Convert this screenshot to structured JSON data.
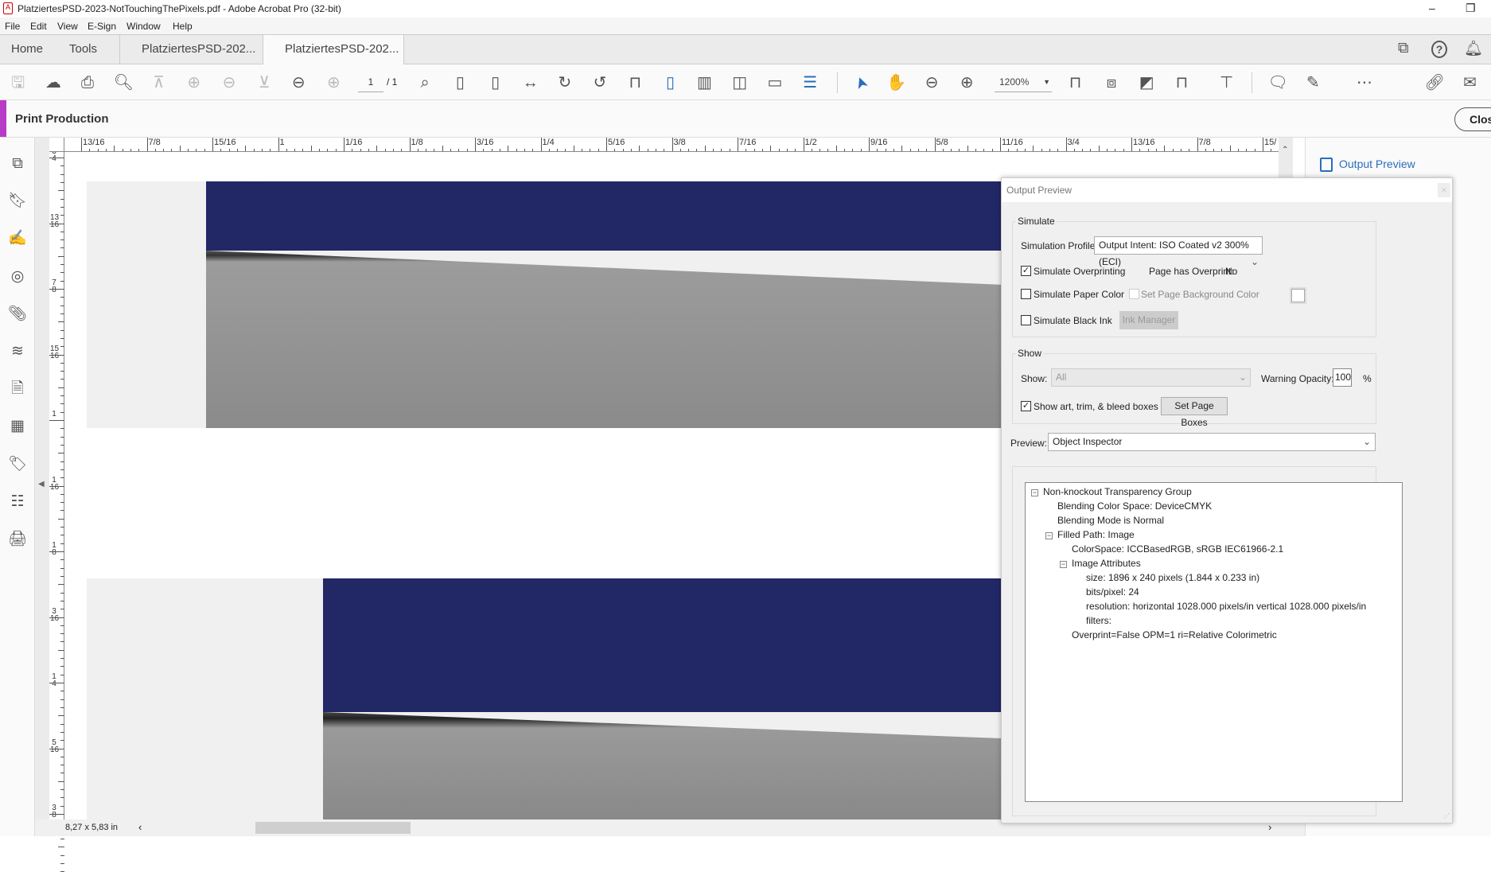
{
  "window": {
    "title": "PlatziertesPSD-2023-NotTouchingThePixels.pdf - Adobe Acrobat Pro (32-bit)",
    "minimize": "–",
    "restore": "❐"
  },
  "menu": [
    "File",
    "Edit",
    "View",
    "E-Sign",
    "Window",
    "Help"
  ],
  "tabs": {
    "home": "Home",
    "tools": "Tools",
    "doc1": "PlatziertesPSD-202...",
    "doc2": "PlatziertesPSD-202...",
    "close": "✖"
  },
  "toolbar": {
    "page_current": "1",
    "page_total": "/ 1",
    "zoom": "1200%"
  },
  "toolbar_icons": [
    "save-icon",
    "cloud-upload-icon",
    "print-icon",
    "zoom-search-icon",
    "first-page-icon",
    "previous-page-icon",
    "next-page-icon",
    "last-page-icon",
    "back-icon",
    "forward-icon",
    "marquee-zoom-icon",
    "actual-size-icon",
    "zoom-to-page-icon",
    "fit-width-icon",
    "rotate-clockwise-icon",
    "rotate-counterclockwise-icon",
    "scrolling-mode-icon",
    "single-page-icon",
    "two-page-scroll-icon",
    "two-page-icon",
    "full-screen-icon",
    "reading-mode-icon",
    "select-arrow-icon",
    "hand-icon",
    "zoom-out-icon",
    "zoom-in-icon",
    "page-width-icon",
    "crop-icon",
    "fit-visible-icon",
    "page-display-icon",
    "measure-icon",
    "comment-icon",
    "highlight-pen-icon",
    "more-icon",
    "share-link-icon",
    "email-icon"
  ],
  "header_icons": [
    "share-screen-icon",
    "help-icon",
    "bell-icon"
  ],
  "tool_panel": {
    "title": "Print Production",
    "close": "Close"
  },
  "accent": "#b73bc6",
  "left_sidebar": [
    "page-thumbnails-icon",
    "bookmarks-icon",
    "signatures-icon",
    "standards-icon",
    "attachments-icon",
    "layers-icon",
    "content-icon",
    "compare-icon",
    "tags-icon",
    "order-icon",
    "preflight-icon"
  ],
  "rulers": {
    "horizontal": [
      "13/16",
      "7/8",
      "15/16",
      "1",
      "1/16",
      "1/8",
      "3/16",
      "1/4",
      "5/16",
      "3/8",
      "7/16",
      "1/2",
      "9/16",
      "5/8",
      "11/16",
      "3/4",
      "13/16",
      "7/8",
      "15/"
    ],
    "vertical": [
      "3/4",
      "13/16",
      "7/8",
      "15/16",
      "1",
      "1/16",
      "1/8",
      "3/16",
      "1/4",
      "5/16",
      "3/8"
    ]
  },
  "status": {
    "page_size": "8,27 x 5,83 in"
  },
  "right_panel": {
    "output_preview_link": "Output Preview"
  },
  "dialog": {
    "title": "Output Preview",
    "simulate": {
      "group": "Simulate",
      "profile_label": "Simulation Profile:",
      "profile_value": "Output Intent: ISO Coated v2 300% (ECI)",
      "overprinting": {
        "label": "Simulate Overprinting",
        "checked": true
      },
      "has_overprint_label": "Page has Overprint:",
      "has_overprint_value": "No",
      "paper_color": {
        "label": "Simulate Paper Color",
        "checked": false
      },
      "page_bg": {
        "label": "Set Page Background Color",
        "checked": false,
        "enabled": false
      },
      "black_ink": {
        "label": "Simulate Black Ink",
        "checked": false
      },
      "ink_manager": "Ink Manager"
    },
    "show": {
      "group": "Show",
      "show_label": "Show:",
      "show_value": "All",
      "opacity_label": "Warning Opacity:",
      "opacity_value": "100",
      "percent": "%",
      "boxes": {
        "label": "Show art, trim, & bleed boxes",
        "checked": true
      },
      "set_page_boxes": "Set Page Boxes"
    },
    "preview_label": "Preview:",
    "preview_value": "Object Inspector",
    "tree": [
      {
        "level": 0,
        "expander": true,
        "text": "Non-knockout Transparency Group"
      },
      {
        "level": 1,
        "expander": false,
        "text": "Blending Color Space: DeviceCMYK"
      },
      {
        "level": 1,
        "expander": false,
        "text": "Blending Mode is Normal"
      },
      {
        "level": 1,
        "expander": true,
        "text": "Filled Path: Image"
      },
      {
        "level": 2,
        "expander": false,
        "text": "ColorSpace: ICCBasedRGB, sRGB IEC61966-2.1"
      },
      {
        "level": 2,
        "expander": true,
        "text": "Image Attributes"
      },
      {
        "level": 3,
        "expander": false,
        "text": "size: 1896 x 240 pixels (1.844 x 0.233 in)"
      },
      {
        "level": 3,
        "expander": false,
        "text": "bits/pixel: 24"
      },
      {
        "level": 3,
        "expander": false,
        "text": "resolution: horizontal 1028.000 pixels/in vertical 1028.000 pixels/in"
      },
      {
        "level": 3,
        "expander": false,
        "text": "filters:"
      },
      {
        "level": 2,
        "expander": false,
        "text": "Overprint=False OPM=1 ri=Relative Colorimetric"
      }
    ]
  }
}
